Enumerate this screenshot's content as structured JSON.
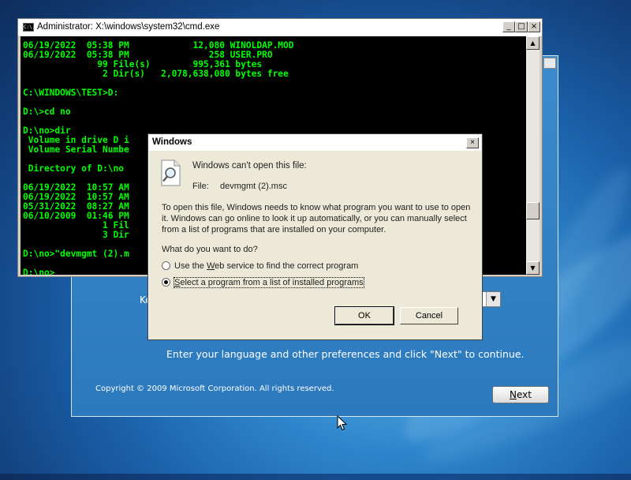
{
  "cmd": {
    "title": "Administrator: X:\\windows\\system32\\cmd.exe",
    "icon": "C:\\.",
    "lines": [
      "06/19/2022  05:38 PM            12,080 WINOLDAP.MOD",
      "06/19/2022  05:38 PM               258 USER.PRO",
      "              99 File(s)        995,361 bytes",
      "               2 Dir(s)   2,078,638,080 bytes free",
      "",
      "C:\\WINDOWS\\TEST>D:",
      "",
      "D:\\>cd no",
      "",
      "D:\\no>dir",
      " Volume in drive D i",
      " Volume Serial Numbe",
      "",
      " Directory of D:\\no",
      "",
      "06/19/2022  10:57 AM",
      "06/19/2022  10:57 AM",
      "05/31/2022  08:27 AM",
      "06/10/2009  01:46 PM",
      "               1 Fil",
      "               3 Dir",
      "",
      "D:\\no>\"devmgmt (2).m",
      "",
      "D:\\no>"
    ],
    "minimize": "_",
    "maximize": "□",
    "close": "×",
    "scroll_up": "▲",
    "scroll_down": "▼"
  },
  "dialog": {
    "title": "Windows",
    "close": "×",
    "heading": "Windows can't open this file:",
    "file_label": "File:",
    "file_name": "devmgmt (2).msc",
    "body": "To open this file, Windows needs to know what program you want to use to open it. Windows can go online to look it up automatically, or you can manually select from a list of programs that are installed on your computer.",
    "question": "What do you want to do?",
    "option_web_pre": "Use the ",
    "option_web_key": "W",
    "option_web_post": "eb service to find the correct program",
    "option_list_pre": "",
    "option_list_key": "S",
    "option_list_post": "elect a program from a list of installed programs",
    "selected_option": "list",
    "ok": "OK",
    "cancel": "Cancel"
  },
  "setup": {
    "keyboard_label": "Ke",
    "dropdown_arrow": "▼",
    "instruction": "Enter your language and other preferences and click \"Next\" to continue.",
    "copyright": "Copyright © 2009 Microsoft Corporation. All rights reserved.",
    "next_key": "N",
    "next_rest": "ext"
  }
}
